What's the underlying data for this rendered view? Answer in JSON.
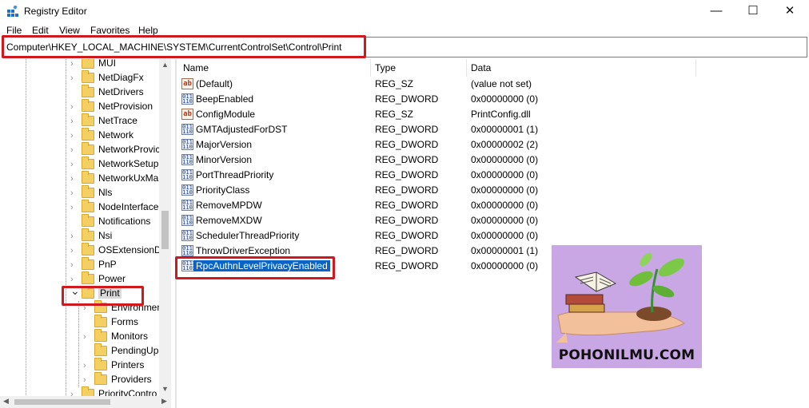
{
  "window": {
    "title": "Registry Editor",
    "minimize": "—",
    "maximize": "☐",
    "close": "✕"
  },
  "menu": [
    "File",
    "Edit",
    "View",
    "Favorites",
    "Help"
  ],
  "address": "Computer\\HKEY_LOCAL_MACHINE\\SYSTEM\\CurrentControlSet\\Control\\Print",
  "tree": {
    "items": [
      {
        "label": "MUI",
        "level": 1,
        "expandable": true
      },
      {
        "label": "NetDiagFx",
        "level": 1,
        "expandable": true
      },
      {
        "label": "NetDrivers",
        "level": 1,
        "expandable": false
      },
      {
        "label": "NetProvision",
        "level": 1,
        "expandable": true
      },
      {
        "label": "NetTrace",
        "level": 1,
        "expandable": true
      },
      {
        "label": "Network",
        "level": 1,
        "expandable": true
      },
      {
        "label": "NetworkProvic",
        "level": 1,
        "expandable": true
      },
      {
        "label": "NetworkSetup",
        "level": 1,
        "expandable": true
      },
      {
        "label": "NetworkUxMa",
        "level": 1,
        "expandable": true
      },
      {
        "label": "Nls",
        "level": 1,
        "expandable": true
      },
      {
        "label": "NodeInterface",
        "level": 1,
        "expandable": true
      },
      {
        "label": "Notifications",
        "level": 1,
        "expandable": false
      },
      {
        "label": "Nsi",
        "level": 1,
        "expandable": true
      },
      {
        "label": "OSExtensionD",
        "level": 1,
        "expandable": true
      },
      {
        "label": "PnP",
        "level": 1,
        "expandable": true
      },
      {
        "label": "Power",
        "level": 1,
        "expandable": true
      },
      {
        "label": "Print",
        "level": 1,
        "expandable": true,
        "expanded": true,
        "selected": true
      },
      {
        "label": "Environmen",
        "level": 2,
        "expandable": true
      },
      {
        "label": "Forms",
        "level": 2,
        "expandable": false
      },
      {
        "label": "Monitors",
        "level": 2,
        "expandable": true
      },
      {
        "label": "PendingUp",
        "level": 2,
        "expandable": false
      },
      {
        "label": "Printers",
        "level": 2,
        "expandable": true
      },
      {
        "label": "Providers",
        "level": 2,
        "expandable": true
      },
      {
        "label": "PriorityContro",
        "level": 1,
        "expandable": true
      }
    ]
  },
  "list": {
    "headers": {
      "name": "Name",
      "type": "Type",
      "data": "Data"
    },
    "rows": [
      {
        "name": "(Default)",
        "type": "REG_SZ",
        "data": "(value not set)",
        "icon": "string-value-icon"
      },
      {
        "name": "BeepEnabled",
        "type": "REG_DWORD",
        "data": "0x00000000 (0)",
        "icon": "binary-value-icon"
      },
      {
        "name": "ConfigModule",
        "type": "REG_SZ",
        "data": "PrintConfig.dll",
        "icon": "string-value-icon"
      },
      {
        "name": "GMTAdjustedForDST",
        "type": "REG_DWORD",
        "data": "0x00000001 (1)",
        "icon": "binary-value-icon"
      },
      {
        "name": "MajorVersion",
        "type": "REG_DWORD",
        "data": "0x00000002 (2)",
        "icon": "binary-value-icon"
      },
      {
        "name": "MinorVersion",
        "type": "REG_DWORD",
        "data": "0x00000000 (0)",
        "icon": "binary-value-icon"
      },
      {
        "name": "PortThreadPriority",
        "type": "REG_DWORD",
        "data": "0x00000000 (0)",
        "icon": "binary-value-icon"
      },
      {
        "name": "PriorityClass",
        "type": "REG_DWORD",
        "data": "0x00000000 (0)",
        "icon": "binary-value-icon"
      },
      {
        "name": "RemoveMPDW",
        "type": "REG_DWORD",
        "data": "0x00000000 (0)",
        "icon": "binary-value-icon"
      },
      {
        "name": "RemoveMXDW",
        "type": "REG_DWORD",
        "data": "0x00000000 (0)",
        "icon": "binary-value-icon"
      },
      {
        "name": "SchedulerThreadPriority",
        "type": "REG_DWORD",
        "data": "0x00000000 (0)",
        "icon": "binary-value-icon"
      },
      {
        "name": "ThrowDriverException",
        "type": "REG_DWORD",
        "data": "0x00000001 (1)",
        "icon": "binary-value-icon"
      },
      {
        "name": "RpcAuthnLevelPrivacyEnabled",
        "type": "REG_DWORD",
        "data": "0x00000000 (0)",
        "icon": "binary-value-icon",
        "selected": true
      }
    ]
  },
  "highlight_color": "#d0181f",
  "selection_color": "#0a64c8",
  "watermark": {
    "text": "POHONILMU.COM",
    "background": "#c9a6e4"
  }
}
